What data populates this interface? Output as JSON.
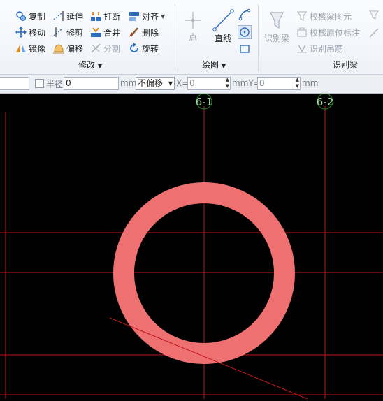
{
  "ribbon": {
    "modify": {
      "title": "修改",
      "copy": "复制",
      "extend": "延伸",
      "break": "打断",
      "align": "对齐",
      "move": "移动",
      "trim": "修剪",
      "merge": "合并",
      "delete": "删除",
      "mirror": "镜像",
      "offset": "偏移",
      "split": "分割",
      "rotate": "旋转"
    },
    "draw": {
      "title": "绘图",
      "point": "点",
      "line": "直线"
    },
    "identify": {
      "title": "识别梁",
      "identify_beam": "识别梁",
      "check_beam": "校核梁图元",
      "check_original": "校核原位标注",
      "identify_hanger": "识别吊筋"
    }
  },
  "options": {
    "radius_label": "半径",
    "radius_value": "0",
    "unit_mm": "mm",
    "offset_mode": "不偏移",
    "x_label": "X=",
    "x_value": "0",
    "unit_mmy": "mmY=",
    "y_value": "0",
    "unit_mm2": "mm"
  },
  "canvas": {
    "axis_labels": [
      "6-1",
      "6-2"
    ],
    "ring_color": "#ee7070",
    "grid_color": "#c01818"
  }
}
